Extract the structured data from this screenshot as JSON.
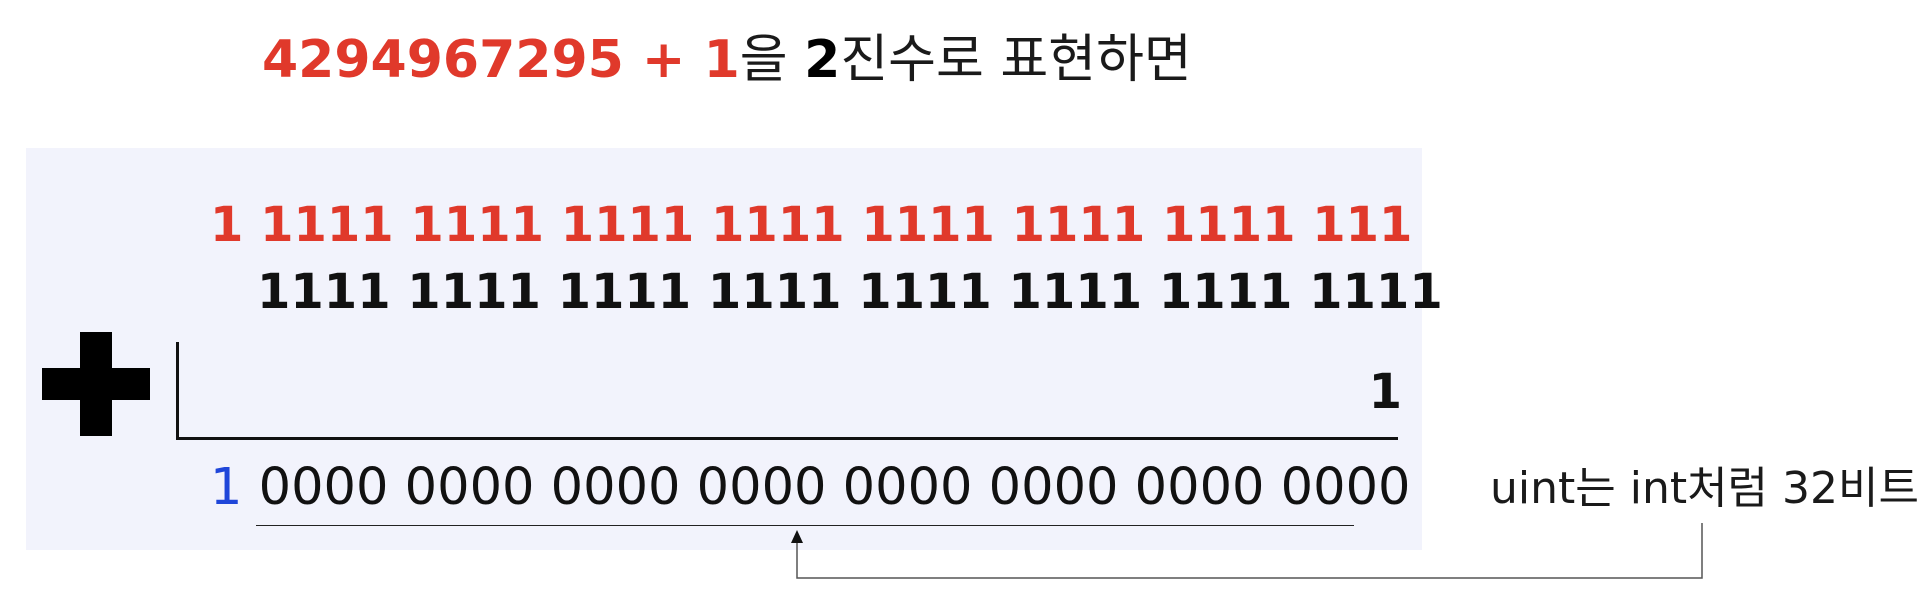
{
  "title": {
    "expression": "4294967295 + 1",
    "particle": "을 ",
    "base": "2",
    "rest": "진수로 표현하면"
  },
  "addition": {
    "carry_row": "1 1111 1111 1111 1111 1111 1111 1111 111",
    "operand": "1111 1111 1111 1111 1111 1111 1111 1111",
    "addend": "1",
    "result_overflow_bit": "1",
    "result_bits": " 0000 0000 0000 0000 0000 0000 0000 0000"
  },
  "note": "uint는 int처럼 32비트",
  "colors": {
    "carry": "#e0392b",
    "overflow": "#1f46d9",
    "panel_bg": "#f2f3fc"
  },
  "icons": {
    "operator": "plus-icon"
  }
}
